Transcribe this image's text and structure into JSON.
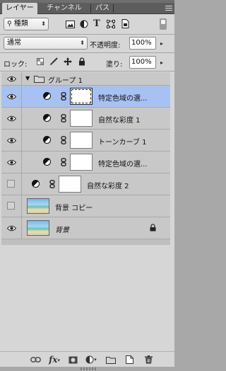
{
  "tabs": [
    {
      "label": "レイヤー",
      "active": true
    },
    {
      "label": "チャンネル",
      "active": false
    },
    {
      "label": "パス",
      "active": false
    }
  ],
  "filter": {
    "kind_label": "種類"
  },
  "blend": {
    "mode": "通常",
    "opacity_label": "不透明度:",
    "opacity_value": "100%"
  },
  "lock": {
    "label": "ロック:",
    "fill_label": "塗り:",
    "fill_value": "100%"
  },
  "layers": [
    {
      "type": "group",
      "name": "グループ 1",
      "visible": true,
      "expanded": true
    },
    {
      "type": "adjustment",
      "name": "特定色域の選...",
      "visible": true,
      "selected": true,
      "indent": true
    },
    {
      "type": "adjustment",
      "name": "自然な彩度 1",
      "visible": true,
      "selected": false,
      "indent": true
    },
    {
      "type": "adjustment",
      "name": "トーンカーブ 1",
      "visible": true,
      "selected": false,
      "indent": true
    },
    {
      "type": "adjustment",
      "name": "特定色域の選...",
      "visible": true,
      "selected": false,
      "indent": true
    },
    {
      "type": "adjustment",
      "name": "自然な彩度 2",
      "visible": false,
      "selected": false,
      "indent": false
    },
    {
      "type": "pixel",
      "name": "背景 コピー",
      "visible": false,
      "selected": false
    },
    {
      "type": "background",
      "name": "背景",
      "visible": true,
      "selected": false,
      "locked": true
    }
  ],
  "bottom_icons": [
    "link-layers-icon",
    "fx-icon",
    "add-mask-icon",
    "new-adjustment-icon",
    "new-group-icon",
    "new-layer-icon",
    "trash-icon"
  ],
  "bottom_labels": {
    "fx": "fx"
  },
  "colors": {
    "selected_row": "#a7c2f2",
    "panel_bg": "#d6d6d6",
    "tab_bar": "#5d5d5d"
  }
}
